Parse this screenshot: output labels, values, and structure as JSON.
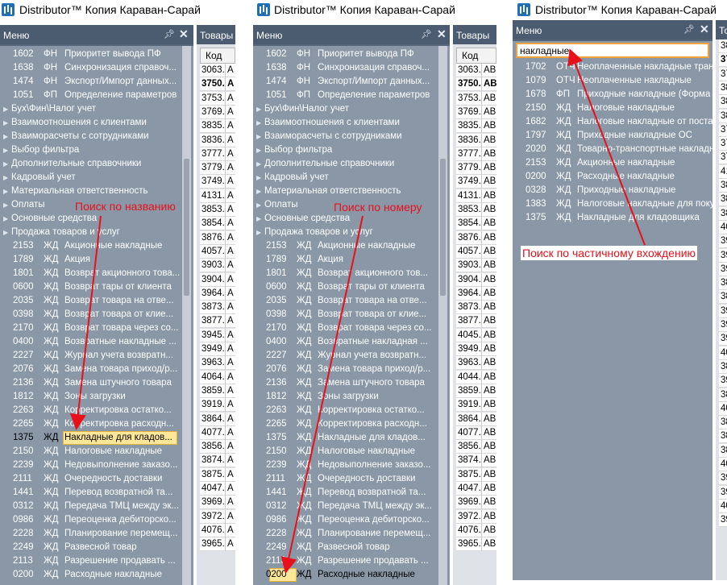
{
  "window_title": "Distributor™ Копия Караван-Сарай",
  "menu_label": "Меню",
  "tovary_label": "Товары",
  "kod_label": "Код",
  "pin_glyph": "ꟷ",
  "close_glyph": "✕",
  "annotations": {
    "by_name": "Поиск по названию",
    "by_number": "Поиск по номеру",
    "by_partial": "Поиск по частичному вхождению"
  },
  "panel1": {
    "typed_text": "Накла",
    "rows": [
      {
        "code": "1602",
        "type": "ФН",
        "name": "Приоритет вывода ПФ"
      },
      {
        "code": "1638",
        "type": "ФН",
        "name": "Синхронизация справоч..."
      },
      {
        "code": "1474",
        "type": "ФН",
        "name": "Экспорт/Импорт данных..."
      },
      {
        "code": "1051",
        "type": "ФП",
        "name": "Определение параметров"
      },
      {
        "group": "Бух\\Фин\\Налог учет"
      },
      {
        "group": "Взаимоотношения с клиентами"
      },
      {
        "group": "Взаиморасчеты с сотрудниками"
      },
      {
        "group": "Выбор фильтра"
      },
      {
        "group": "Дополнительные справочники"
      },
      {
        "group": "Кадровый учет"
      },
      {
        "group": "Материальная ответственность"
      },
      {
        "group": "Оплаты"
      },
      {
        "group": "Основные средства"
      },
      {
        "group": "Продажа товаров и услуг"
      },
      {
        "code": "2153",
        "type": "ЖД",
        "name": "Акционные накладные"
      },
      {
        "code": "1789",
        "type": "ЖД",
        "name": "Акция"
      },
      {
        "code": "1801",
        "type": "ЖД",
        "name": "Возврат акционного това..."
      },
      {
        "code": "0600",
        "type": "ЖД",
        "name": "Возврат тары от клиента"
      },
      {
        "code": "2035",
        "type": "ЖД",
        "name": "Возврат товара на отве..."
      },
      {
        "code": "0398",
        "type": "ЖД",
        "name": "Возврат товара от клие..."
      },
      {
        "code": "2170",
        "type": "ЖД",
        "name": "Возврат товара через со..."
      },
      {
        "code": "0400",
        "type": "ЖД",
        "name": "Возвратные накладные ..."
      },
      {
        "code": "2227",
        "type": "ЖД",
        "name": "Журнал учета возвратн..."
      },
      {
        "code": "2076",
        "type": "ЖД",
        "name": "Замена товара приход/р..."
      },
      {
        "code": "2136",
        "type": "ЖД",
        "name": "Замена штучного товара"
      },
      {
        "code": "1812",
        "type": "ЖД",
        "name": "Зоны загрузки"
      },
      {
        "code": "2263",
        "type": "ЖД",
        "name": "Корректировка остатко..."
      },
      {
        "code": "2265",
        "type": "ЖД",
        "name": "Корректировка расходн..."
      },
      {
        "code": "1375",
        "type": "ЖД",
        "name": "Накладные для кладов..."
      },
      {
        "code": "2150",
        "type": "ЖД",
        "name": "Налоговые накладные"
      },
      {
        "code": "2239",
        "type": "ЖД",
        "name": "Недовыполнение заказо..."
      },
      {
        "code": "2111",
        "type": "ЖД",
        "name": "Очередность доставки"
      },
      {
        "code": "1441",
        "type": "ЖД",
        "name": "Перевод возвратной та..."
      },
      {
        "code": "0312",
        "type": "ЖД",
        "name": "Передача ТМЦ между эк..."
      },
      {
        "code": "0986",
        "type": "ЖД",
        "name": "Переоценка дебиторско..."
      },
      {
        "code": "2228",
        "type": "ЖД",
        "name": "Планирование перемещ..."
      },
      {
        "code": "2249",
        "type": "ЖД",
        "name": "Развесной товар"
      },
      {
        "code": "2113",
        "type": "ЖД",
        "name": "Разрешение продавать ..."
      },
      {
        "code": "0200",
        "type": "ЖД",
        "name": "Расходные накладные"
      }
    ],
    "codes": [
      "3063.",
      "3750.",
      "3753.",
      "3769.",
      "3835.",
      "3836.",
      "3777.",
      "3779.",
      "3749.",
      "4131.",
      "3853.",
      "3854.",
      "3876.",
      "4057.",
      "3903.",
      "3904.",
      "3964.",
      "3873.",
      "3877.",
      "3945.",
      "3949.",
      "3963.",
      "4064.",
      "3859.",
      "3919.",
      "3864.",
      "4077.",
      "3856.",
      "3874.",
      "3875.",
      "4047.",
      "3969.",
      "3972.",
      "4076.",
      "3965."
    ],
    "col2": "А"
  },
  "panel2": {
    "typed_text": "020",
    "rows": [
      {
        "code": "1602",
        "type": "ФН",
        "name": "Приоритет вывода ПФ"
      },
      {
        "code": "1638",
        "type": "ФН",
        "name": "Синхронизация справоч..."
      },
      {
        "code": "1474",
        "type": "ФН",
        "name": "Экспорт/Импорт данных..."
      },
      {
        "code": "1051",
        "type": "ФП",
        "name": "Определение параметров"
      },
      {
        "group": "Бух\\Фин\\Налог учет"
      },
      {
        "group": "Взаимоотношения с клиентами"
      },
      {
        "group": "Взаиморасчеты с сотрудниками"
      },
      {
        "group": "Выбор фильтра"
      },
      {
        "group": "Дополнительные справочники"
      },
      {
        "group": "Кадровый учет"
      },
      {
        "group": "Материальная ответственность"
      },
      {
        "group": "Оплаты"
      },
      {
        "group": "Основные средства"
      },
      {
        "group": "Продажа товаров и услуг"
      },
      {
        "code": "2153",
        "type": "ЖД",
        "name": "Акционные накладные"
      },
      {
        "code": "1789",
        "type": "ЖД",
        "name": "Акция"
      },
      {
        "code": "1801",
        "type": "ЖД",
        "name": "Возврат акционного тов..."
      },
      {
        "code": "0600",
        "type": "ЖД",
        "name": "Возврат тары от клиента"
      },
      {
        "code": "2035",
        "type": "ЖД",
        "name": "Возврат товара на отве..."
      },
      {
        "code": "0398",
        "type": "ЖД",
        "name": "Возврат товара от клие..."
      },
      {
        "code": "2170",
        "type": "ЖД",
        "name": "Возврат товара через со..."
      },
      {
        "code": "0400",
        "type": "ЖД",
        "name": "Возвратные накладная ..."
      },
      {
        "code": "2227",
        "type": "ЖД",
        "name": "Журнал учета возвратн..."
      },
      {
        "code": "2076",
        "type": "ЖД",
        "name": "Замена товара приход/р..."
      },
      {
        "code": "2136",
        "type": "ЖД",
        "name": "Замена штучного товара"
      },
      {
        "code": "1812",
        "type": "ЖД",
        "name": "Зоны загрузки"
      },
      {
        "code": "2263",
        "type": "ЖД",
        "name": "Корректировка остатко..."
      },
      {
        "code": "2265",
        "type": "ЖД",
        "name": "Корректировка расходн..."
      },
      {
        "code": "1375",
        "type": "ЖД",
        "name": "Накладные для кладов..."
      },
      {
        "code": "2150",
        "type": "ЖД",
        "name": "Налоговые накладные"
      },
      {
        "code": "2239",
        "type": "ЖД",
        "name": "Недовыполнение заказо..."
      },
      {
        "code": "2111",
        "type": "ЖД",
        "name": "Очередность доставки"
      },
      {
        "code": "1441",
        "type": "ЖД",
        "name": "Перевод возвратной та..."
      },
      {
        "code": "0312",
        "type": "ЖД",
        "name": "Передача ТМЦ между эк..."
      },
      {
        "code": "0986",
        "type": "ЖД",
        "name": "Переоценка дебиторско..."
      },
      {
        "code": "2228",
        "type": "ЖД",
        "name": "Планирование перемещ..."
      },
      {
        "code": "2249",
        "type": "ЖД",
        "name": "Развесной товар"
      },
      {
        "code": "2113",
        "type": "ЖД",
        "name": "Разрешение продавать ..."
      },
      {
        "code": "0200",
        "type": "ЖД",
        "name": "Расходные накладные"
      }
    ],
    "codes": [
      "3063.",
      "3750.",
      "3753.",
      "3769.",
      "3835.",
      "3836.",
      "3777.",
      "3779.",
      "3749.",
      "4131.",
      "3853.",
      "3854.",
      "3876.",
      "4057.",
      "3903.",
      "3904.",
      "3964.",
      "3873.",
      "3877.",
      "4045.",
      "3949.",
      "3963.",
      "4044.",
      "3859.",
      "3919.",
      "3864.",
      "4077.",
      "3856.",
      "3874.",
      "3875.",
      "4047.",
      "3969.",
      "3972.",
      "4076.",
      "3965."
    ],
    "col2": "АВН"
  },
  "panel3": {
    "search_value": "накладные",
    "rows": [
      {
        "code": "1702",
        "type": "ОТЧ",
        "name": "Неоплаченные накладные трансп"
      },
      {
        "code": "1079",
        "type": "ОТЧ",
        "name": "Неоплаченные накладные"
      },
      {
        "code": "1678",
        "type": "ФП",
        "name": "Приходные накладные (Форма оп..."
      },
      {
        "code": "2150",
        "type": "ЖД",
        "name": "Налоговые накладные"
      },
      {
        "code": "1682",
        "type": "ЖД",
        "name": "Налоговые накладные от постав..."
      },
      {
        "code": "1797",
        "type": "ЖД",
        "name": "Приходные накладные ОС"
      },
      {
        "code": "2020",
        "type": "ЖД",
        "name": "Товарно-транспортные накладны"
      },
      {
        "code": "2153",
        "type": "ЖД",
        "name": "Акционные накладные"
      },
      {
        "code": "0200",
        "type": "ЖД",
        "name": "Расходные накладные"
      },
      {
        "code": "0328",
        "type": "ЖД",
        "name": "Приходные накладные"
      },
      {
        "code": "1383",
        "type": "ЖД",
        "name": "Налоговые накладные для покупа"
      },
      {
        "code": "1375",
        "type": "ЖД",
        "name": "Накладные для кладовщика"
      }
    ],
    "codes": [
      "38",
      "37",
      "37",
      "38",
      "38",
      "38",
      "37",
      "37",
      "37",
      "41",
      "38",
      "38",
      "38",
      "40",
      "39",
      "39",
      "39",
      "38",
      "38",
      "39",
      "39",
      "39",
      "40",
      "38",
      "39",
      "38",
      "40",
      "38",
      "38",
      "38",
      "40",
      "39",
      "39",
      "40",
      "39"
    ]
  }
}
